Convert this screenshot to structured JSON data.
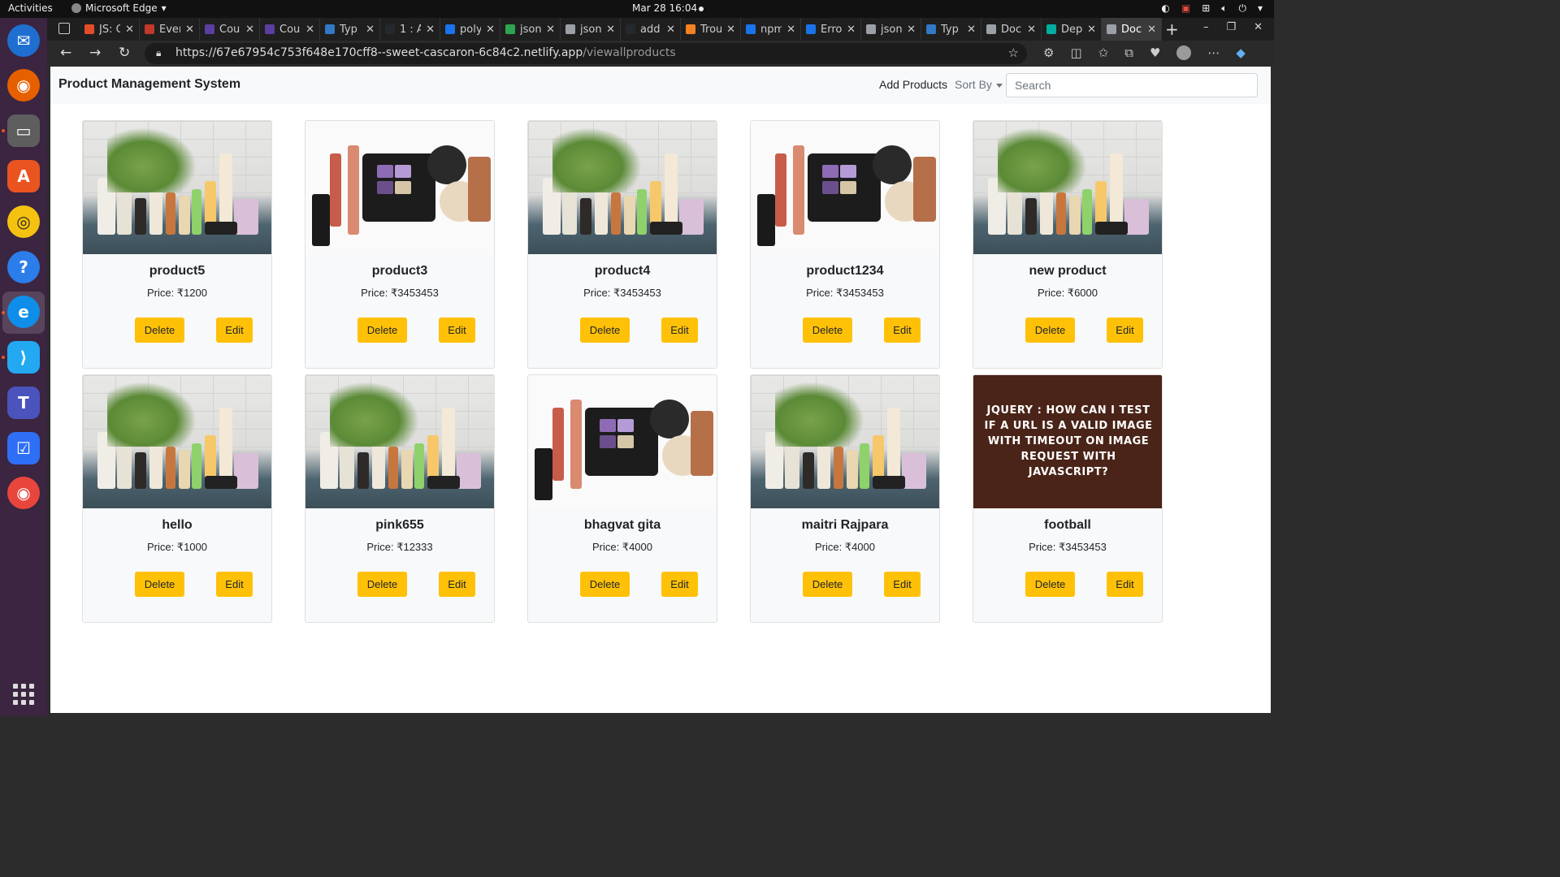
{
  "system_bar": {
    "activities": "Activities",
    "app_name": "Microsoft Edge",
    "clock": "Mar 28  16:04"
  },
  "browser": {
    "tabs": [
      {
        "label": "JS: C",
        "fav_color": "#e34c26"
      },
      {
        "label": "Even",
        "fav_color": "#c0392b"
      },
      {
        "label": "Cou",
        "fav_color": "#5a3fa0"
      },
      {
        "label": "Cou",
        "fav_color": "#5a3fa0"
      },
      {
        "label": "Typ",
        "fav_color": "#3178c6"
      },
      {
        "label": "1 : A",
        "fav_color": "#24292e"
      },
      {
        "label": "poly",
        "fav_color": "#1a73e8"
      },
      {
        "label": "json",
        "fav_color": "#2ea44f"
      },
      {
        "label": "json",
        "fav_color": "#9aa0a6"
      },
      {
        "label": "add",
        "fav_color": "#24292e"
      },
      {
        "label": "Trou",
        "fav_color": "#f48024"
      },
      {
        "label": "npm",
        "fav_color": "#1a73e8"
      },
      {
        "label": "Erro",
        "fav_color": "#1a73e8"
      },
      {
        "label": "json",
        "fav_color": "#9aa0a6"
      },
      {
        "label": "Typ",
        "fav_color": "#3178c6"
      },
      {
        "label": "Doc",
        "fav_color": "#9aa0a6"
      },
      {
        "label": "Dep",
        "fav_color": "#00ad9f"
      },
      {
        "label": "Doc",
        "fav_color": "#9aa0a6"
      }
    ],
    "url_host": "https://67e67954c753f648e170cff8--sweet-cascaron-6c84c2.netlify.app",
    "url_path": "/viewallproducts"
  },
  "navbar": {
    "brand": "Product Management System",
    "add_products": "Add Products",
    "sort_by": "Sort By",
    "search_placeholder": "Search"
  },
  "products": [
    {
      "name": "product5",
      "price": "Price: ₹1200",
      "image": "plant-toiletries"
    },
    {
      "name": "product3",
      "price": "Price: ₹3453453",
      "image": "cosmetics"
    },
    {
      "name": "product4",
      "price": "Price: ₹3453453",
      "image": "plant-toiletries"
    },
    {
      "name": "product1234",
      "price": "Price: ₹3453453",
      "image": "cosmetics"
    },
    {
      "name": "new product",
      "price": "Price: ₹6000",
      "image": "plant-toiletries"
    },
    {
      "name": "hello",
      "price": "Price: ₹1000",
      "image": "plant-toiletries"
    },
    {
      "name": "pink655",
      "price": "Price: ₹12333",
      "image": "plant-toiletries"
    },
    {
      "name": "bhagvat gita",
      "price": "Price: ₹4000",
      "image": "cosmetics"
    },
    {
      "name": "maitri Rajpara",
      "price": "Price: ₹4000",
      "image": "plant-toiletries"
    },
    {
      "name": "football",
      "price": "Price: ₹3453453",
      "image": "jquery-text",
      "image_text": "JQUERY : HOW CAN I TEST IF A URL IS A VALID IMAGE WITH TIMEOUT ON IMAGE REQUEST WITH JAVASCRIPT?"
    }
  ],
  "buttons": {
    "delete": "Delete",
    "edit": "Edit"
  }
}
